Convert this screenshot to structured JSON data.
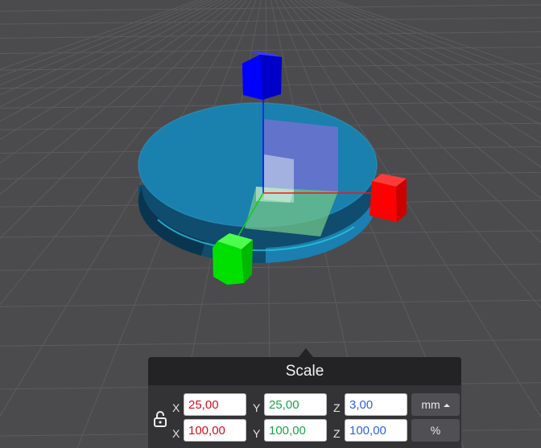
{
  "scene": {
    "colors": {
      "background": "#4b4b4d",
      "grid": "#5c5c5e",
      "model_top": "#1a80ad",
      "model_side": "#0f4c6e",
      "handle_x": "#ff0000",
      "handle_y": "#00e000",
      "handle_z": "#0000ff"
    },
    "icons": {
      "x_handle": "cube-handle-icon",
      "y_handle": "cube-handle-icon",
      "z_handle": "cube-handle-icon"
    }
  },
  "scale_panel": {
    "title": "Scale",
    "lock_icon": "unlock-icon",
    "mm_row": {
      "x_label": "X",
      "x_value": "25,00",
      "y_label": "Y",
      "y_value": "25,00",
      "z_label": "Z",
      "z_value": "3,00",
      "unit_label": "mm"
    },
    "percent_row": {
      "x_label": "X",
      "x_value": "100,00",
      "y_label": "Y",
      "y_value": "100,00",
      "z_label": "Z",
      "z_value": "100,00",
      "unit_label": "%"
    }
  }
}
